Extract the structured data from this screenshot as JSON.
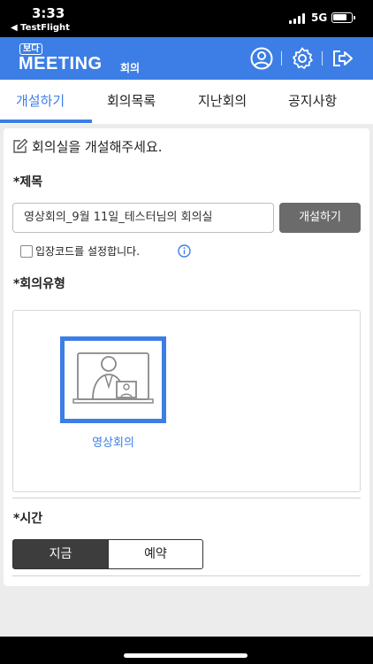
{
  "status_bar": {
    "time": "3:33",
    "back_app": "◀ TestFlight",
    "network": "5G"
  },
  "header": {
    "logo_small": "보다",
    "logo_main": "MEETING",
    "logo_sub": "회의",
    "brand_color": "#3c7ee5",
    "icons": [
      "user-icon",
      "settings-gear-icon",
      "logout-icon"
    ]
  },
  "tabs": [
    {
      "label": "개설하기",
      "active": true
    },
    {
      "label": "회의목록",
      "active": false
    },
    {
      "label": "지난회의",
      "active": false
    },
    {
      "label": "공지사항",
      "active": false
    }
  ],
  "form": {
    "heading": "회의실을 개설해주세요.",
    "title_label": "*제목",
    "title_value": "영상회의_9월 11일_테스터님의 회의실",
    "create_button": "개설하기",
    "entry_code_label": "입장코드를 설정합니다.",
    "entry_code_checked": false,
    "meeting_type_label": "*회의유형",
    "meeting_types": [
      {
        "label": "영상회의",
        "icon": "video-meeting-icon",
        "selected": true
      }
    ],
    "time_label": "*시간",
    "time_options": [
      {
        "label": "지금",
        "selected": true
      },
      {
        "label": "예약",
        "selected": false
      }
    ]
  }
}
